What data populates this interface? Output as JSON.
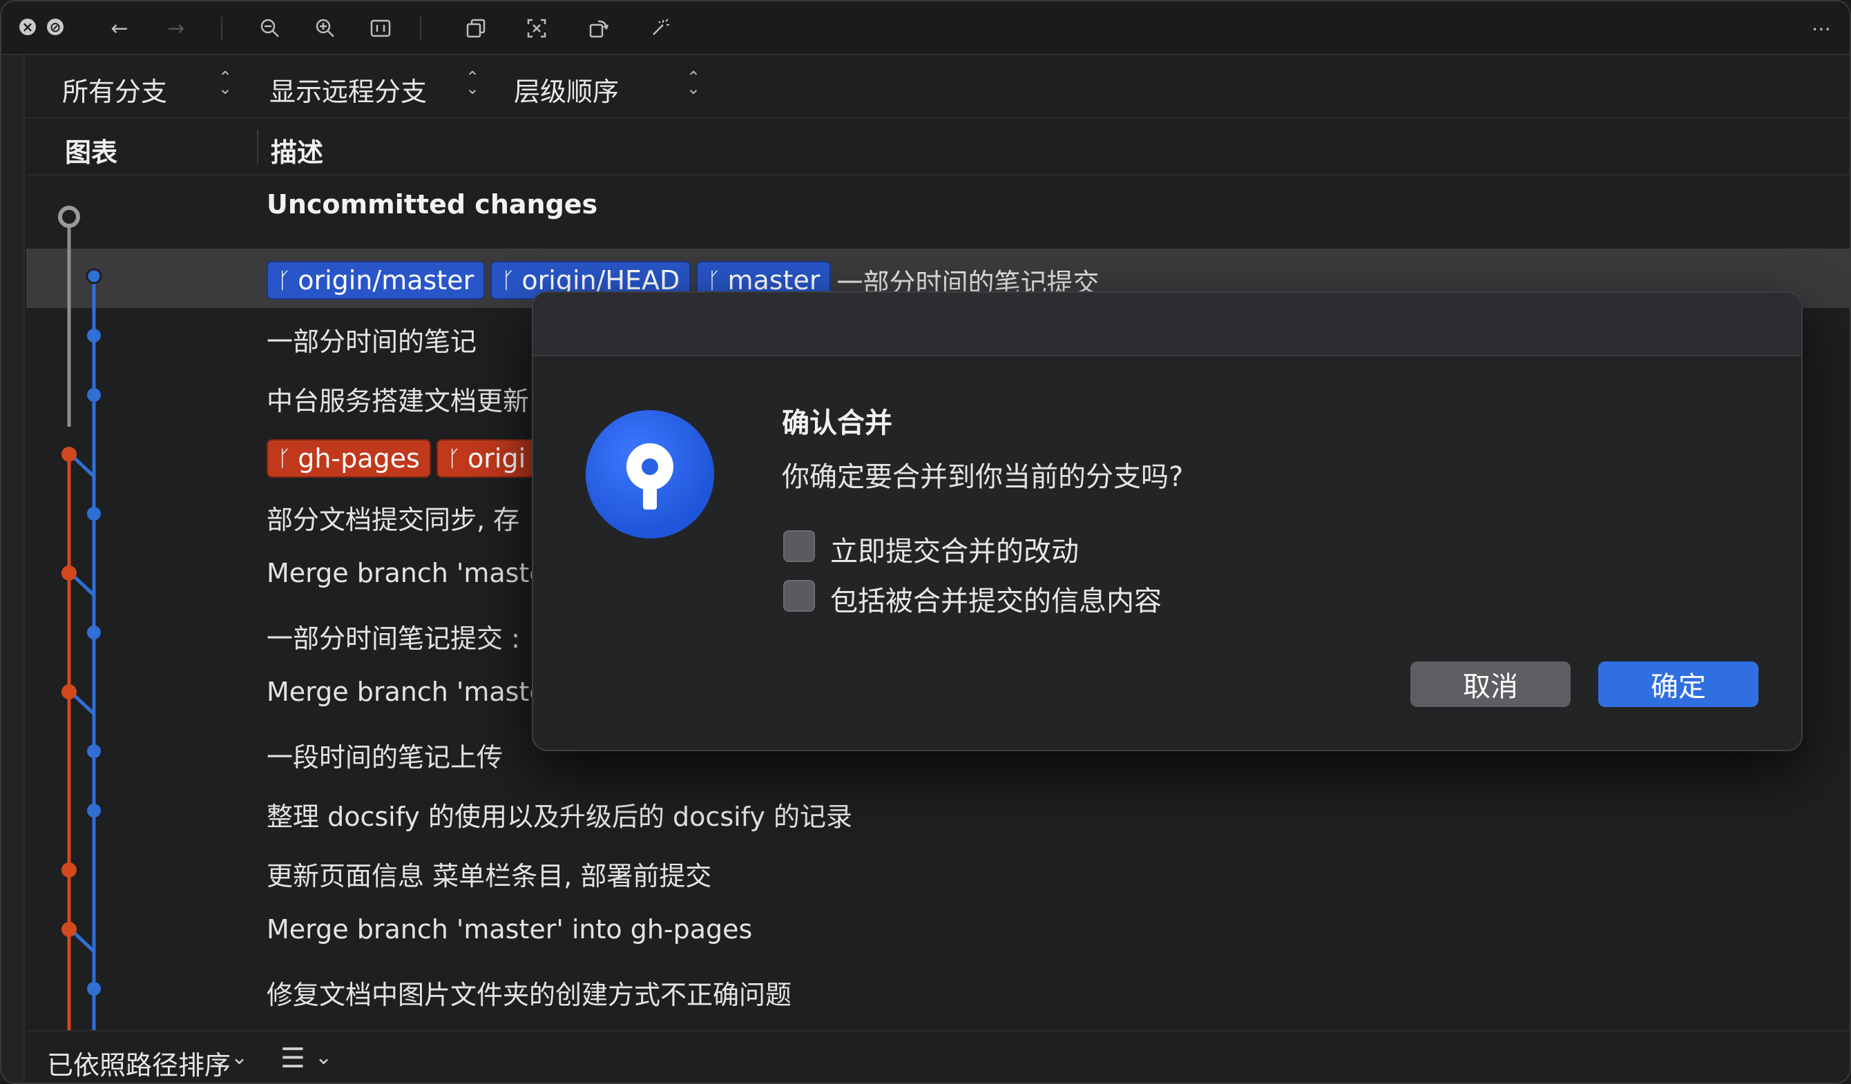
{
  "toolbar": {
    "icons": [
      "close-icon",
      "stop-icon",
      "back-arrow-icon",
      "forward-arrow-icon",
      "zoom-out-icon",
      "zoom-in-icon",
      "fit-icon",
      "copy-icon",
      "select-icon",
      "rotate-icon",
      "magic-icon",
      "more-icon"
    ]
  },
  "filters": {
    "branches": "所有分支",
    "remote": "显示远程分支",
    "order": "层级顺序"
  },
  "columns": {
    "graph": "图表",
    "description": "描述"
  },
  "commits": [
    {
      "text": "Uncommitted changes",
      "tags": []
    },
    {
      "text": "一部分时间的笔记提交",
      "tags": [
        {
          "label": "origin/master",
          "color": "blue"
        },
        {
          "label": "origin/HEAD",
          "color": "blue"
        },
        {
          "label": "master",
          "color": "blue"
        }
      ]
    },
    {
      "text": "一部分时间的笔记",
      "tags": []
    },
    {
      "text": "中台服务搭建文档更新",
      "tags": []
    },
    {
      "text": "",
      "tags": [
        {
          "label": "gh-pages",
          "color": "red"
        },
        {
          "label": "origi",
          "color": "red"
        }
      ]
    },
    {
      "text": "部分文档提交同步, 存",
      "tags": []
    },
    {
      "text": "Merge branch 'maste",
      "tags": []
    },
    {
      "text": "一部分时间笔记提交 :",
      "tags": []
    },
    {
      "text": "Merge branch 'maste",
      "tags": []
    },
    {
      "text": "一段时间的笔记上传",
      "tags": []
    },
    {
      "text": "整理 docsify 的使用以及升级后的 docsify 的记录",
      "tags": []
    },
    {
      "text": "更新页面信息 菜单栏条目, 部署前提交",
      "tags": []
    },
    {
      "text": "Merge branch 'master' into gh-pages",
      "tags": []
    },
    {
      "text": "修复文档中图片文件夹的创建方式不正确问题",
      "tags": []
    }
  ],
  "bottom": {
    "sort_label": "已依照路径排序"
  },
  "dialog": {
    "title": "确认合并",
    "message": "你确定要合并到你当前的分支吗?",
    "option1": "立即提交合并的改动",
    "option2": "包括被合并提交的信息内容",
    "cancel": "取消",
    "ok": "确定"
  },
  "colors": {
    "blue_branch": "#2f6fd6",
    "red_branch": "#d4481f",
    "accent": "#2f6fe0"
  }
}
